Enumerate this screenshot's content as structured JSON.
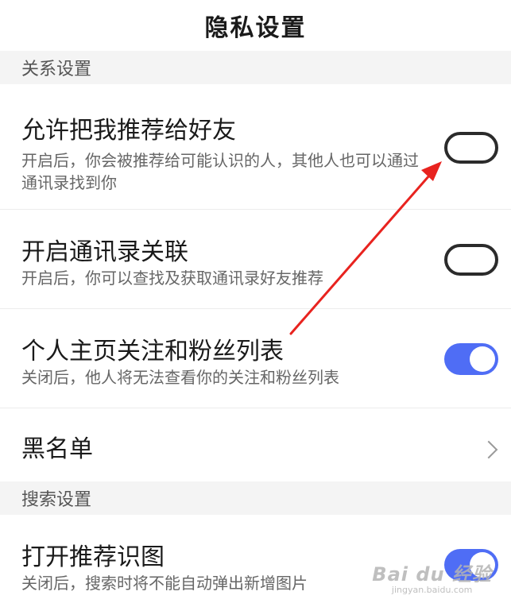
{
  "header": {
    "title": "隐私设置"
  },
  "sections": {
    "relationship": {
      "label": "关系设置",
      "items": [
        {
          "title": "允许把我推荐给好友",
          "description": "开启后，你会被推荐给可能认识的人，其他人也可以通过通讯录找到你",
          "toggle": "off"
        },
        {
          "title": "开启通讯录关联",
          "description": "开启后，你可以查找及获取通讯录好友推荐",
          "toggle": "off"
        },
        {
          "title": "个人主页关注和粉丝列表",
          "description": "关闭后，他人将无法查看你的关注和粉丝列表",
          "toggle": "on"
        },
        {
          "title": "黑名单",
          "icon": "chevron-right-icon"
        }
      ]
    },
    "search": {
      "label": "搜索设置",
      "items": [
        {
          "title": "打开推荐识图",
          "description": "关闭后，搜索时将不能自动弹出新增图片",
          "toggle": "on"
        }
      ]
    }
  },
  "watermark": {
    "main": "Bai du 经验",
    "sub": "jingyan.baidu.com"
  },
  "colors": {
    "toggle_on": "#4f6df5",
    "toggle_off_border": "#2b2b2b",
    "section_bg": "#f4f4f4",
    "annotation_arrow": "#e8231f"
  }
}
